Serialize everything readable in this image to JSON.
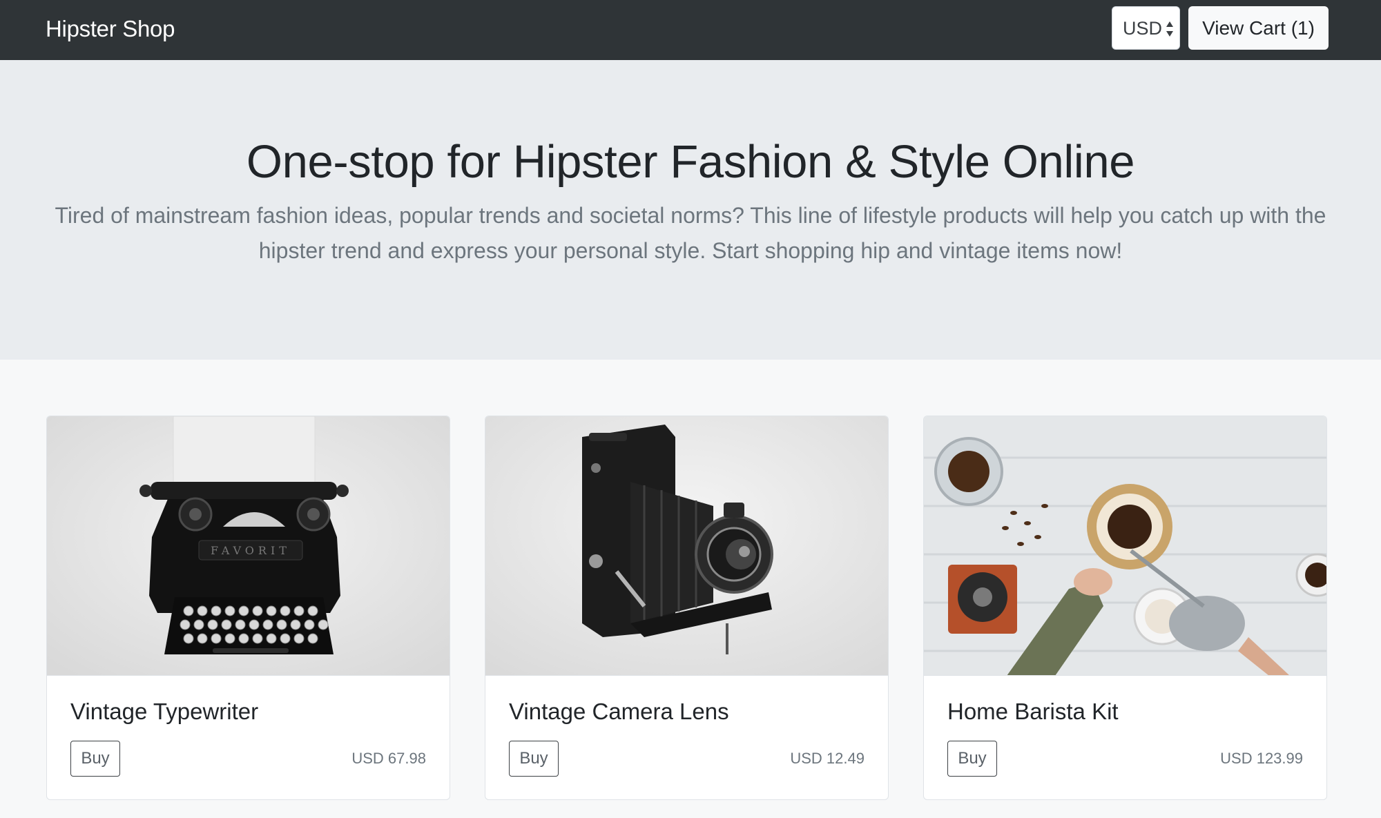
{
  "navbar": {
    "brand": "Hipster Shop",
    "currency": "USD",
    "cart_label": "View Cart (1)"
  },
  "hero": {
    "title": "One-stop for Hipster Fashion & Style Online",
    "lead": "Tired of mainstream fashion ideas, popular trends and societal norms? This line of lifestyle products will help you catch up with the hipster trend and express your personal style. Start shopping hip and vintage items now!"
  },
  "products": [
    {
      "name": "Vintage Typewriter",
      "buy_label": "Buy",
      "price": "USD 67.98",
      "image": "typewriter-image"
    },
    {
      "name": "Vintage Camera Lens",
      "buy_label": "Buy",
      "price": "USD 12.49",
      "image": "camera-image"
    },
    {
      "name": "Home Barista Kit",
      "buy_label": "Buy",
      "price": "USD 123.99",
      "image": "barista-kit-image"
    }
  ],
  "colors": {
    "navbar_bg": "#2f3437",
    "hero_bg": "#e9ecef",
    "page_bg": "#f7f8f9",
    "muted_text": "#6c757d"
  }
}
